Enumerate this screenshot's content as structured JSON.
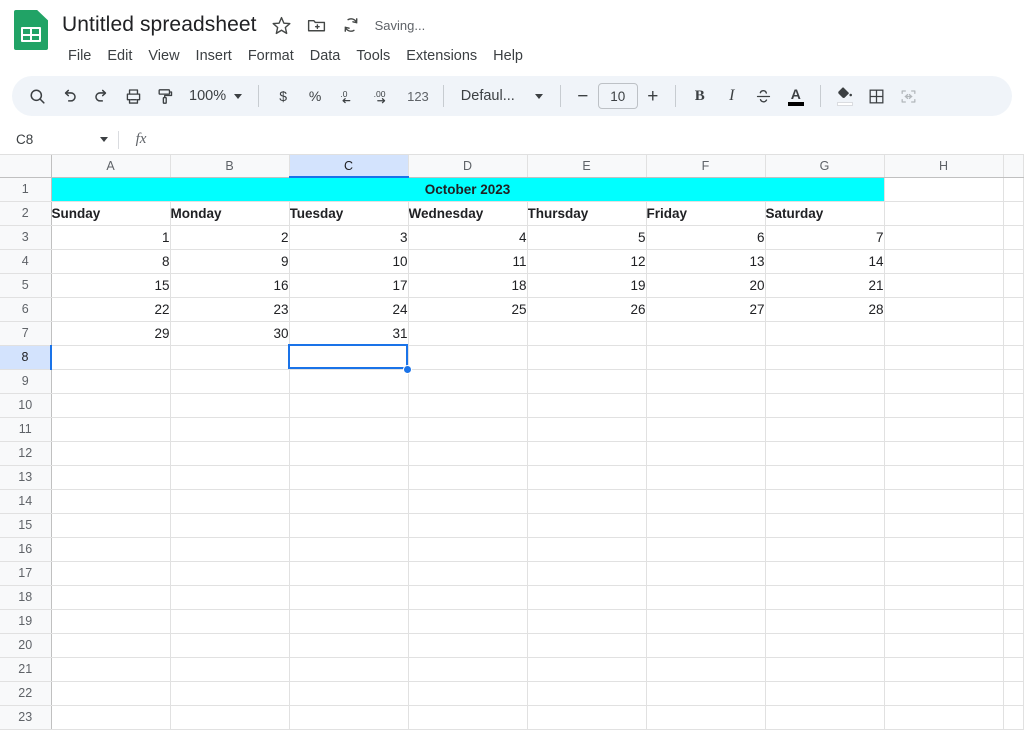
{
  "app": {
    "doc_title": "Untitled spreadsheet",
    "save_status": "Saving...",
    "logo_name": "google-sheets-logo"
  },
  "title_icons": [
    {
      "name": "star-icon",
      "glyph": "☆"
    },
    {
      "name": "move-to-folder-icon",
      "glyph": "folder-plus"
    },
    {
      "name": "version-history-icon",
      "glyph": "history-arc"
    }
  ],
  "menu": {
    "items": [
      "File",
      "Edit",
      "View",
      "Insert",
      "Format",
      "Data",
      "Tools",
      "Extensions",
      "Help"
    ]
  },
  "toolbar": {
    "search_icon": "search-icon",
    "undo_icon": "undo-icon",
    "redo_icon": "redo-icon",
    "print_icon": "print-icon",
    "paint_format_icon": "paint-format-icon",
    "zoom_value": "100%",
    "currency_label": "$",
    "percent_label": "%",
    "decrease_decimal_label": ".0",
    "increase_decimal_label": ".00",
    "number_format_label": "123",
    "font_family": "Defaul...",
    "decrease_font_label": "−",
    "font_size": "10",
    "increase_font_label": "+",
    "bold_label": "B",
    "italic_label": "I",
    "strikethrough_icon": "strikethrough-icon",
    "text_color_label": "A",
    "fill_color_icon": "fill-color-icon",
    "borders_icon": "borders-icon",
    "merge_cells_icon": "merge-cells-icon"
  },
  "formula_bar": {
    "name_box": "C8",
    "fx_label": "fx",
    "formula_value": ""
  },
  "grid": {
    "columns": [
      "A",
      "B",
      "C",
      "D",
      "E",
      "F",
      "G",
      "H"
    ],
    "active_column": "C",
    "active_row": 8,
    "selected_cell": "C8",
    "banner": {
      "text": "October 2023",
      "color": "#00FFFF",
      "span": "A1:G1"
    },
    "day_headers": [
      "Sunday",
      "Monday",
      "Tuesday",
      "Wednesday",
      "Thursday",
      "Friday",
      "Saturday"
    ],
    "weeks": [
      [
        "1",
        "2",
        "3",
        "4",
        "5",
        "6",
        "7"
      ],
      [
        "8",
        "9",
        "10",
        "11",
        "12",
        "13",
        "14"
      ],
      [
        "15",
        "16",
        "17",
        "18",
        "19",
        "20",
        "21"
      ],
      [
        "22",
        "23",
        "24",
        "25",
        "26",
        "27",
        "28"
      ],
      [
        "29",
        "30",
        "31",
        "",
        "",
        "",
        ""
      ]
    ],
    "row_numbers": [
      1,
      2,
      3,
      4,
      5,
      6,
      7,
      8,
      9,
      10,
      11,
      12,
      13,
      14,
      15,
      16,
      17,
      18,
      19,
      20,
      21,
      22,
      23
    ]
  },
  "colors": {
    "accent": "#1a73e8",
    "banner_cyan": "#00FFFF",
    "sheets_green": "#21a366",
    "header_bg": "#f8f9fa",
    "toolbar_bg": "#f0f4f9",
    "active_header_bg": "#d3e3fd"
  }
}
